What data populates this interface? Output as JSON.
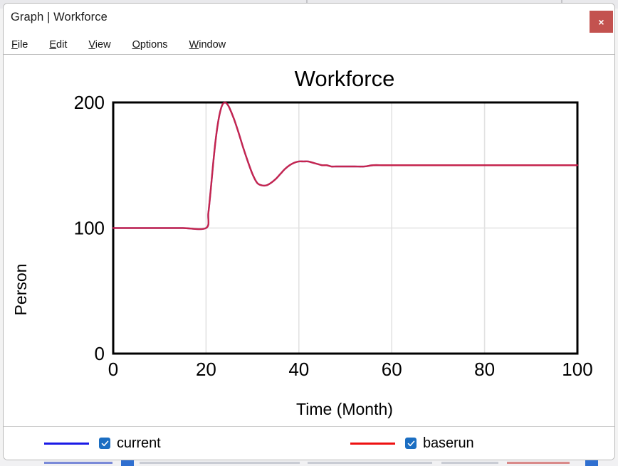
{
  "window": {
    "title": "Graph | Workforce",
    "close_label": "×",
    "close_color": "#c3524f"
  },
  "menu": {
    "items": [
      {
        "label": "File",
        "accelerator": "F"
      },
      {
        "label": "Edit",
        "accelerator": "E"
      },
      {
        "label": "View",
        "accelerator": "V"
      },
      {
        "label": "Options",
        "accelerator": "O"
      },
      {
        "label": "Window",
        "accelerator": "W"
      }
    ]
  },
  "legend": {
    "entries": [
      {
        "label": "current",
        "color": "#1a1ae6",
        "checked": true
      },
      {
        "label": "baserun",
        "color": "#ee1111",
        "checked": true
      }
    ]
  },
  "chart_data": {
    "type": "line",
    "title": "Workforce",
    "xlabel": "Time (Month)",
    "ylabel": "Person",
    "xlim": [
      0,
      100
    ],
    "ylim": [
      0,
      200
    ],
    "xticks": [
      0,
      20,
      40,
      60,
      80,
      100
    ],
    "yticks": [
      0,
      100,
      200
    ],
    "grid": true,
    "grid_color": "#e2e2e2",
    "axis_color": "#000000",
    "legend_position": "below",
    "overlap_color": "#7b2fd0",
    "series": [
      {
        "name": "current",
        "color": "#1a1ae6",
        "x": [
          0,
          5,
          10,
          15,
          20,
          20.5,
          21,
          21.5,
          22,
          22.5,
          23,
          23.5,
          24,
          24.5,
          25,
          26,
          27,
          28,
          29,
          30,
          31,
          32,
          33,
          34,
          35,
          36,
          37,
          38,
          39,
          40,
          41,
          42,
          43,
          44,
          45,
          46,
          47,
          48,
          50,
          52,
          54,
          56,
          58,
          60,
          65,
          70,
          75,
          80,
          85,
          90,
          95,
          100
        ],
        "values": [
          100,
          100,
          100,
          100,
          100,
          112,
          130,
          150,
          168,
          182,
          192,
          198,
          200,
          199,
          196,
          187,
          176,
          164,
          153,
          143,
          136,
          134,
          134,
          136,
          139,
          143,
          147,
          150,
          152,
          153,
          153,
          153,
          152,
          151,
          150,
          150,
          149,
          149,
          149,
          149,
          149,
          150,
          150,
          150,
          150,
          150,
          150,
          150,
          150,
          150,
          150,
          150
        ]
      },
      {
        "name": "baserun",
        "color": "#ee1111",
        "x": [
          0,
          5,
          10,
          15,
          20,
          20.5,
          21,
          21.5,
          22,
          22.5,
          23,
          23.5,
          24,
          24.5,
          25,
          26,
          27,
          28,
          29,
          30,
          31,
          32,
          33,
          34,
          35,
          36,
          37,
          38,
          39,
          40,
          41,
          42,
          43,
          44,
          45,
          46,
          47,
          48,
          50,
          52,
          54,
          56,
          58,
          60,
          65,
          70,
          75,
          80,
          85,
          90,
          95,
          100
        ],
        "values": [
          100,
          100,
          100,
          100,
          100,
          112,
          130,
          150,
          168,
          182,
          192,
          198,
          200,
          199,
          196,
          187,
          176,
          164,
          153,
          143,
          136,
          134,
          134,
          136,
          139,
          143,
          147,
          150,
          152,
          153,
          153,
          153,
          152,
          151,
          150,
          150,
          149,
          149,
          149,
          149,
          149,
          150,
          150,
          150,
          150,
          150,
          150,
          150,
          150,
          150,
          150,
          150
        ]
      }
    ]
  }
}
